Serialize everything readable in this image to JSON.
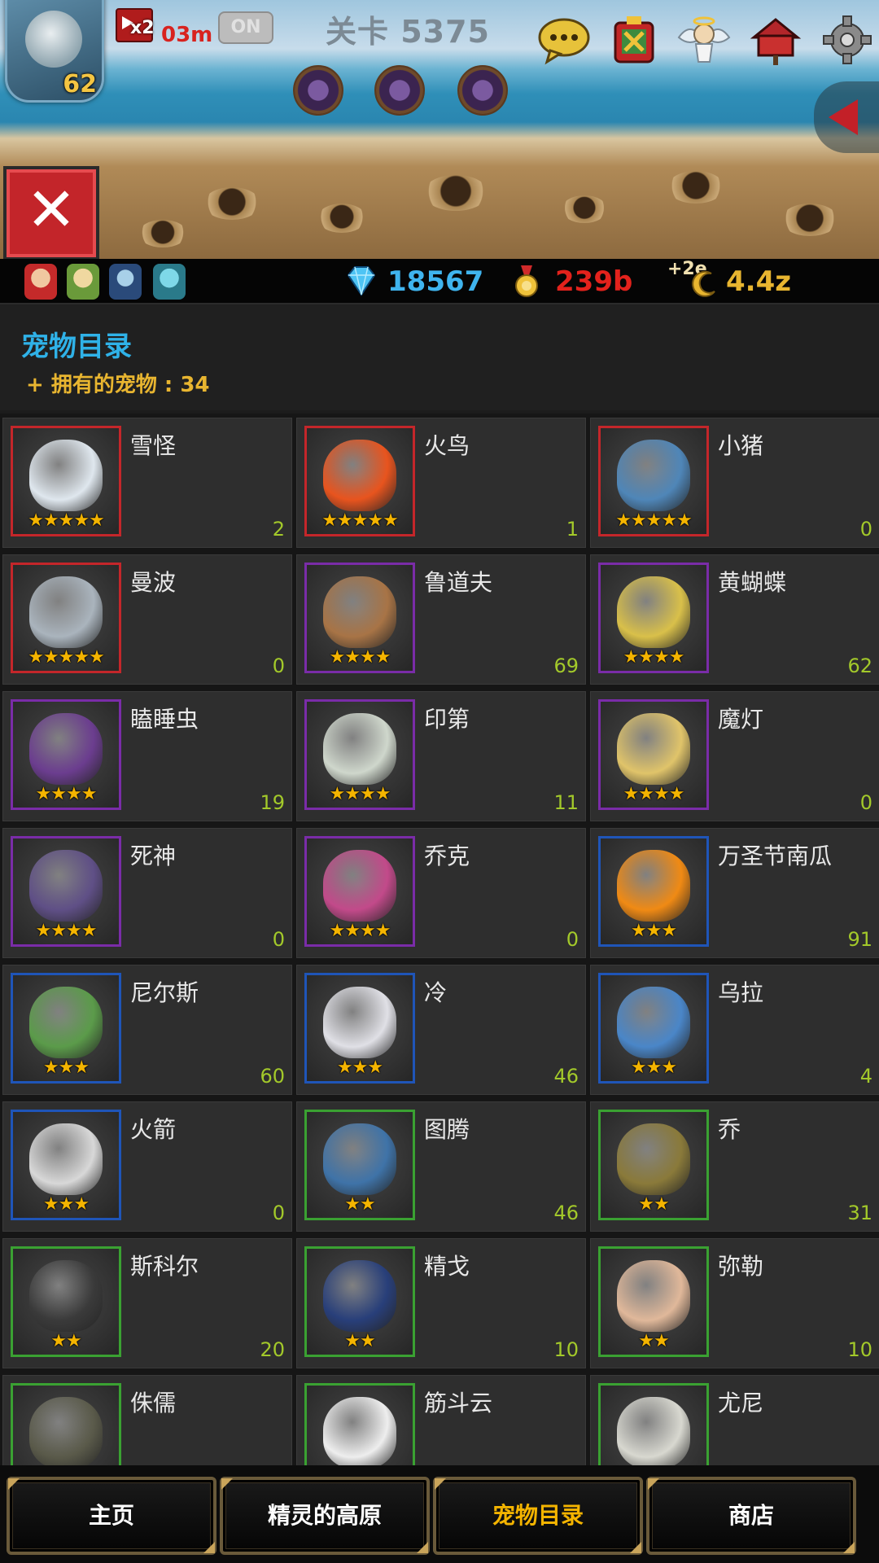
{
  "hud": {
    "player_level": "62",
    "speed_multiplier": "x2",
    "speed_time": "03m",
    "auto_toggle": "ON",
    "stage_title": "关卡 5375"
  },
  "resources": {
    "gems": "18567",
    "gold": "239b",
    "bonus_prefix": "+2e",
    "souls": "4.4z"
  },
  "catalog": {
    "title": "宠物目录",
    "owned_label": "+ 拥有的宠物 : 34"
  },
  "pets": [
    {
      "name": "雪怪",
      "count": "2",
      "stars": 5,
      "rarity": "red",
      "art": "#dfe7ee"
    },
    {
      "name": "火鸟",
      "count": "1",
      "stars": 5,
      "rarity": "red",
      "art": "#e8541e"
    },
    {
      "name": "小猪",
      "count": "0",
      "stars": 5,
      "rarity": "red",
      "art": "#4f86b8"
    },
    {
      "name": "曼波",
      "count": "0",
      "stars": 5,
      "rarity": "red",
      "art": "#aab4bd"
    },
    {
      "name": "鲁道夫",
      "count": "69",
      "stars": 4,
      "rarity": "purple",
      "art": "#a87446"
    },
    {
      "name": "黄蝴蝶",
      "count": "62",
      "stars": 4,
      "rarity": "purple",
      "art": "#d9c04a"
    },
    {
      "name": "瞌睡虫",
      "count": "19",
      "stars": 4,
      "rarity": "purple",
      "art": "#6b3d8f"
    },
    {
      "name": "印第",
      "count": "11",
      "stars": 4,
      "rarity": "purple",
      "art": "#cfd7cc"
    },
    {
      "name": "魔灯",
      "count": "0",
      "stars": 4,
      "rarity": "purple",
      "art": "#e0c46a"
    },
    {
      "name": "死神",
      "count": "0",
      "stars": 4,
      "rarity": "purple",
      "art": "#5f4f86"
    },
    {
      "name": "乔克",
      "count": "0",
      "stars": 4,
      "rarity": "purple",
      "art": "#c24a8a"
    },
    {
      "name": "万圣节南瓜",
      "count": "91",
      "stars": 3,
      "rarity": "blue",
      "art": "#f08a14"
    },
    {
      "name": "尼尔斯",
      "count": "60",
      "stars": 3,
      "rarity": "blue",
      "art": "#5b9b4a"
    },
    {
      "name": "冷",
      "count": "46",
      "stars": 3,
      "rarity": "blue",
      "art": "#e0e0e6"
    },
    {
      "name": "乌拉",
      "count": "4",
      "stars": 3,
      "rarity": "blue",
      "art": "#4a86c8"
    },
    {
      "name": "火箭",
      "count": "0",
      "stars": 3,
      "rarity": "blue",
      "art": "#d8d8d8"
    },
    {
      "name": "图腾",
      "count": "46",
      "stars": 2,
      "rarity": "green",
      "art": "#3f73a8"
    },
    {
      "name": "乔",
      "count": "31",
      "stars": 2,
      "rarity": "green",
      "art": "#8a7a3a"
    },
    {
      "name": "斯科尔",
      "count": "20",
      "stars": 2,
      "rarity": "green",
      "art": "#3a3a3a"
    },
    {
      "name": "精戈",
      "count": "10",
      "stars": 2,
      "rarity": "green",
      "art": "#283f7a"
    },
    {
      "name": "弥勒",
      "count": "10",
      "stars": 2,
      "rarity": "green",
      "art": "#e0b89a"
    },
    {
      "name": "侏儒",
      "count": "",
      "stars": 0,
      "rarity": "green",
      "art": "#5a5a4a"
    },
    {
      "name": "筋斗云",
      "count": "",
      "stars": 0,
      "rarity": "green",
      "art": "#eeeeee"
    },
    {
      "name": "尤尼",
      "count": "",
      "stars": 0,
      "rarity": "green",
      "art": "#d8d8d0"
    }
  ],
  "rarity_colors": {
    "red": "#c4262a",
    "purple": "#7a2ca8",
    "blue": "#1f55b8",
    "green": "#3aa132"
  },
  "nav": [
    {
      "label": "主页",
      "active": false
    },
    {
      "label": "精灵的高原",
      "active": false
    },
    {
      "label": "宠物目录",
      "active": true
    },
    {
      "label": "商店",
      "active": false
    }
  ],
  "colors": {
    "gems": "#3fb4ee",
    "gold": "#e3221c",
    "souls": "#e8b530",
    "count": "#a3c92a",
    "title": "#2fb2e8"
  }
}
